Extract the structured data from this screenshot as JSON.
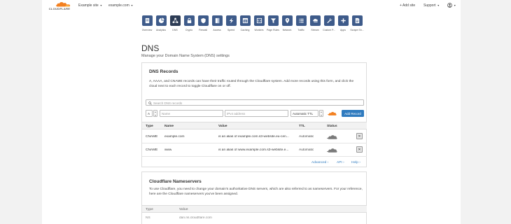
{
  "header": {
    "logo_text": "CLOUDFLARE",
    "account": "Example site",
    "domain": "example.com",
    "add_site": "+ Add site",
    "support": "Support"
  },
  "nav": [
    {
      "label": "Overview",
      "icon": "overview-icon"
    },
    {
      "label": "Analytics",
      "icon": "analytics-icon"
    },
    {
      "label": "DNS",
      "icon": "dns-icon",
      "active": true
    },
    {
      "label": "Crypto",
      "icon": "lock-icon"
    },
    {
      "label": "Firewall",
      "icon": "shield-icon"
    },
    {
      "label": "Access",
      "icon": "access-icon"
    },
    {
      "label": "Speed",
      "icon": "lightning-icon"
    },
    {
      "label": "Caching",
      "icon": "caching-icon"
    },
    {
      "label": "Workers",
      "icon": "workers-icon"
    },
    {
      "label": "Page Rules",
      "icon": "filter-icon"
    },
    {
      "label": "Network",
      "icon": "location-icon"
    },
    {
      "label": "Traffic",
      "icon": "list-icon"
    },
    {
      "label": "Stream",
      "icon": "stream-icon"
    },
    {
      "label": "Custom P...",
      "icon": "wrench-icon"
    },
    {
      "label": "Apps",
      "icon": "plus-icon"
    },
    {
      "label": "Scrape Sh...",
      "icon": "document-icon"
    }
  ],
  "page": {
    "title": "DNS",
    "subtitle": "Manage your Domain Name System (DNS) settings"
  },
  "dns_card": {
    "title": "DNS Records",
    "description": "A, AAAA, and CNAME records can have their traffic routed through the Cloudflare system. Add more records using this form, and click the cloud next to each record to toggle Cloudflare on or off.",
    "search_placeholder": "Search DNS records",
    "add_form": {
      "type": "A",
      "name_placeholder": "Name",
      "ip_placeholder": "IPv4 address",
      "ttl": "Automatic TTL",
      "add_label": "Add Record"
    },
    "columns": [
      "Type",
      "Name",
      "Value",
      "TTL",
      "Status"
    ],
    "records": [
      {
        "type": "CNAME",
        "name": "example.com",
        "value": "is an alias of example.com.s3-website.eu-cen...",
        "ttl": "Automatic"
      },
      {
        "type": "CNAME",
        "name": "www",
        "value": "is an alias of www.example.com.s3-website.e...",
        "ttl": "Automatic"
      }
    ],
    "delete_glyph": "✕",
    "links": {
      "advanced": "Advanced ›",
      "api": "API ›",
      "help": "Help ›"
    }
  },
  "ns_card": {
    "title": "Cloudflare Nameservers",
    "description": "To use Cloudflare, you need to change your domain's authoritative DNS servers, which are also referred to as nameservers. For your reference, here are the Cloudflare nameservers you've been assigned.",
    "columns": [
      "Type",
      "Value"
    ],
    "records": [
      {
        "type": "NS",
        "value": "dan.ns.cloudflare.com"
      }
    ]
  },
  "colors": {
    "nav_tile": "#3e5b8a",
    "accent_blue": "#2f7bbf",
    "cloudflare_orange": "#f38020"
  }
}
